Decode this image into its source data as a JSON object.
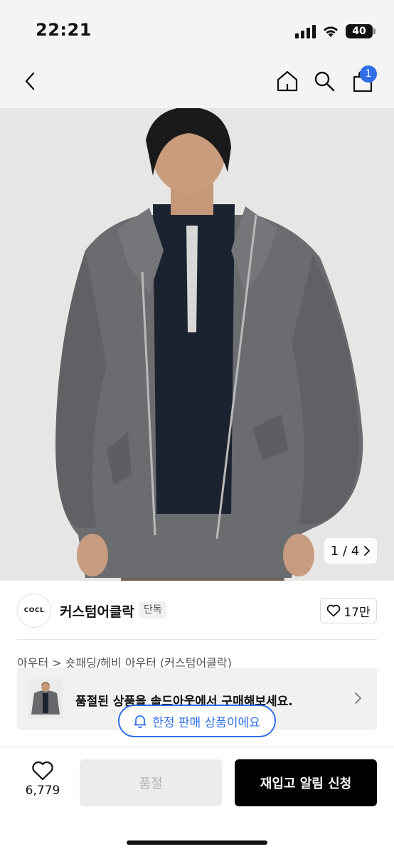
{
  "status_bar": {
    "time": "22:21",
    "battery": "40"
  },
  "nav": {
    "back_icon": "chevron-left-icon",
    "home_icon": "home-icon",
    "search_icon": "search-icon",
    "bag_icon": "shopping-bag-icon",
    "cart_count": "1",
    "badge_color": "#2f6fe8"
  },
  "gallery": {
    "pager": "1 / 4",
    "current": 1,
    "total": 4
  },
  "brand": {
    "logo_text": "COCL",
    "name": "커스텀어클락",
    "exclusive_tag": "단독",
    "like_count": "17만"
  },
  "breadcrumb": "아우터 > 숏패딩/헤비 아우터 (커스텀어클락)",
  "soldout_banner": {
    "message": "품절된 상품을 솔드아웃에서 구매해보세요."
  },
  "limited_pill": {
    "label": "한정 판매 상품이에요",
    "icon": "bell-icon",
    "color": "#2f6fe8"
  },
  "bottom_bar": {
    "wish_count": "6,779",
    "soldout_label": "품절",
    "restock_label": "재입고 알림 신청"
  }
}
